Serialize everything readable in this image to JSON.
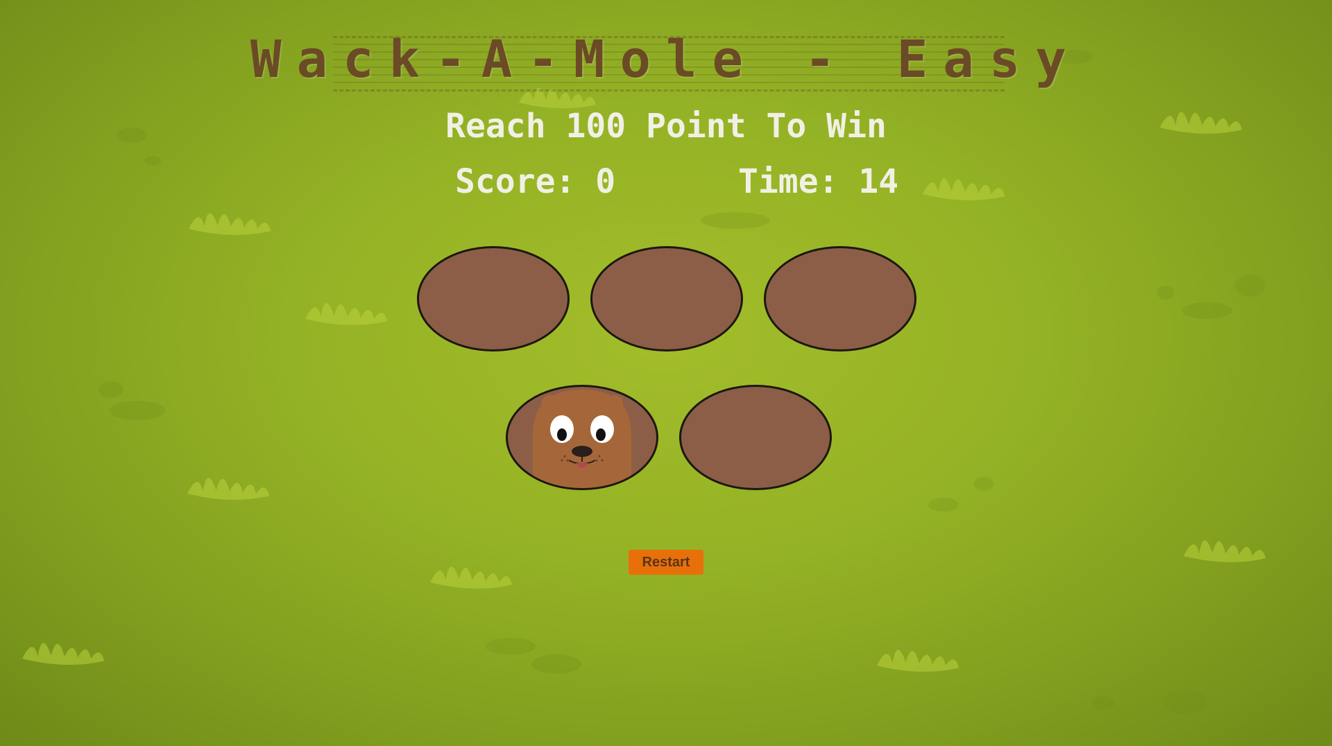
{
  "game": {
    "title": "Wack-A-Mole - Easy",
    "goal_text": "Reach 100 Point To Win",
    "score_label": "Score: 0",
    "time_label": "Time: 14",
    "score_value": 0,
    "time_value": 14
  },
  "board": {
    "holes": [
      {
        "id": 1,
        "has_mole": false
      },
      {
        "id": 2,
        "has_mole": false
      },
      {
        "id": 3,
        "has_mole": false
      },
      {
        "id": 4,
        "has_mole": true
      },
      {
        "id": 5,
        "has_mole": false
      }
    ]
  },
  "controls": {
    "restart_label": "Restart"
  },
  "colors": {
    "background": "#94b225",
    "title": "#6b4a26",
    "text": "#f1f0e4",
    "hole": "#8c5e47",
    "hole_border": "#1c1710",
    "mole": "#a5673a",
    "button": "#e8700a"
  },
  "icons": {
    "mole": "mole-character",
    "grass": "grass-tuft"
  }
}
